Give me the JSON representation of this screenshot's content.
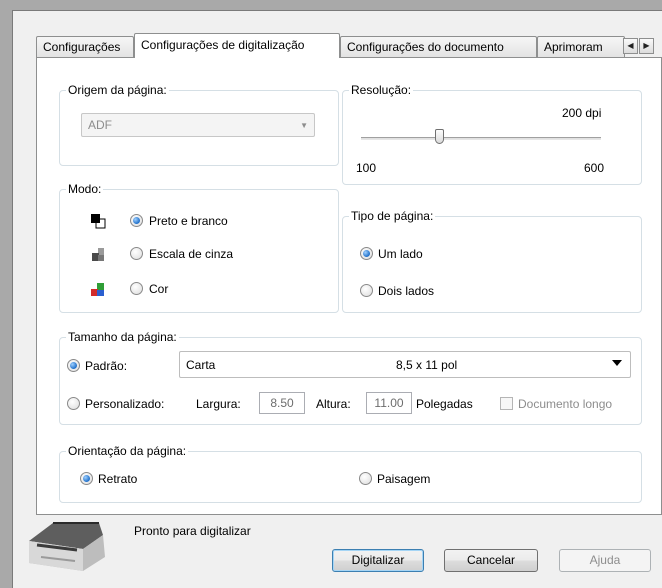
{
  "tabs": [
    {
      "label": "Configurações",
      "active": false
    },
    {
      "label": "Configurações de digitalização",
      "active": true
    },
    {
      "label": "Configurações do documento",
      "active": false
    },
    {
      "label": "Aprimoram",
      "active": false
    }
  ],
  "tab_scroll": {
    "left": "◀",
    "right": "▶"
  },
  "source": {
    "title": "Origem da página:",
    "value": "ADF",
    "arrow": "▼"
  },
  "resolution": {
    "title": "Resolução:",
    "value_label": "200 dpi",
    "min_label": "100",
    "max_label": "600",
    "min": 100,
    "max": 600,
    "value": 200
  },
  "mode": {
    "title": "Modo:",
    "options": [
      {
        "label": "Preto e branco",
        "checked": true,
        "icon": "black-white-icon"
      },
      {
        "label": "Escala de cinza",
        "checked": false,
        "icon": "grayscale-icon"
      },
      {
        "label": "Cor",
        "checked": false,
        "icon": "color-icon"
      }
    ]
  },
  "page_type": {
    "title": "Tipo de página:",
    "options": [
      {
        "label": "Um lado",
        "checked": true
      },
      {
        "label": "Dois lados",
        "checked": false
      }
    ]
  },
  "page_size": {
    "title": "Tamanho da página:",
    "standard_label": "Padrão:",
    "standard_checked": true,
    "size_name": "Carta",
    "size_dims": "8,5 x 11 pol",
    "custom_label": "Personalizado:",
    "custom_checked": false,
    "width_label": "Largura:",
    "width_value": "8.50",
    "height_label": "Altura:",
    "height_value": "11.00",
    "units_label": "Polegadas",
    "long_doc_label": "Documento longo",
    "long_doc_checked": false
  },
  "orientation": {
    "title": "Orientação da página:",
    "options": [
      {
        "label": "Retrato",
        "checked": true
      },
      {
        "label": "Paisagem",
        "checked": false
      }
    ]
  },
  "footer": {
    "status": "Pronto para digitalizar",
    "scan_button": "Digitalizar",
    "cancel_button": "Cancelar",
    "help_button": "Ajuda"
  },
  "colors": {
    "accent": "#1f6fc9",
    "group_border": "#d5dfe5",
    "disabled_text": "#8d8d8d"
  }
}
